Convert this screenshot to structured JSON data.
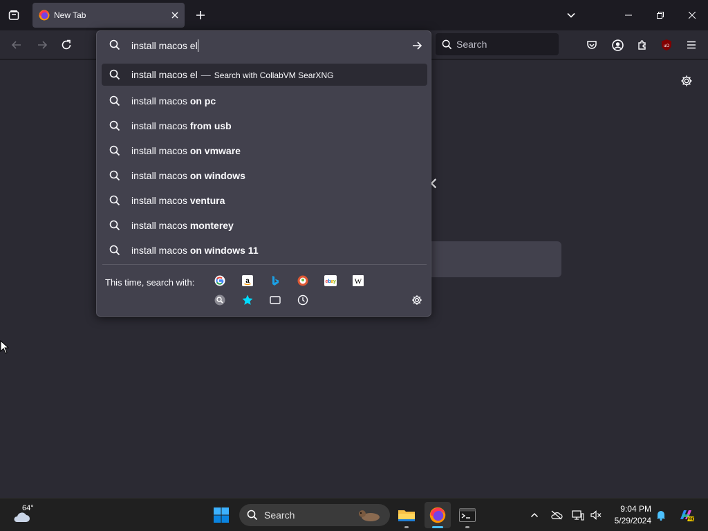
{
  "browser": {
    "tab": {
      "title": "New Tab"
    },
    "toolbar_search": {
      "placeholder": "Search"
    }
  },
  "urlbar": {
    "value": "install macos el",
    "results": [
      {
        "prefix": "install macos el",
        "bold": "",
        "separator": "—",
        "action": "Search with CollabVM SearXNG",
        "selected": true
      },
      {
        "prefix": "install macos ",
        "bold": "on pc"
      },
      {
        "prefix": "install macos ",
        "bold": "from usb"
      },
      {
        "prefix": "install macos ",
        "bold": "on vmware"
      },
      {
        "prefix": "install macos ",
        "bold": "on windows"
      },
      {
        "prefix": "install macos ",
        "bold": "ventura"
      },
      {
        "prefix": "install macos ",
        "bold": "monterey"
      },
      {
        "prefix": "install macos ",
        "bold": "on windows 11"
      }
    ],
    "one_off_label": "This time, search with:",
    "engines": [
      "google-icon",
      "amazon-icon",
      "bing-icon",
      "duckduckgo-icon",
      "ebay-icon",
      "wikipedia-icon",
      "searxng-icon",
      "bookmarks-icon",
      "tabs-icon",
      "history-icon"
    ]
  },
  "taskbar": {
    "weather_temp": "64°",
    "search_label": "Search",
    "time": "9:04 PM",
    "date": "5/29/2024"
  },
  "colors": {
    "accent": "#4cc2ff",
    "panel": "#42414d",
    "toolbar": "#2b2a33",
    "tabbar": "#1c1b22",
    "ublock_red": "#800000"
  }
}
